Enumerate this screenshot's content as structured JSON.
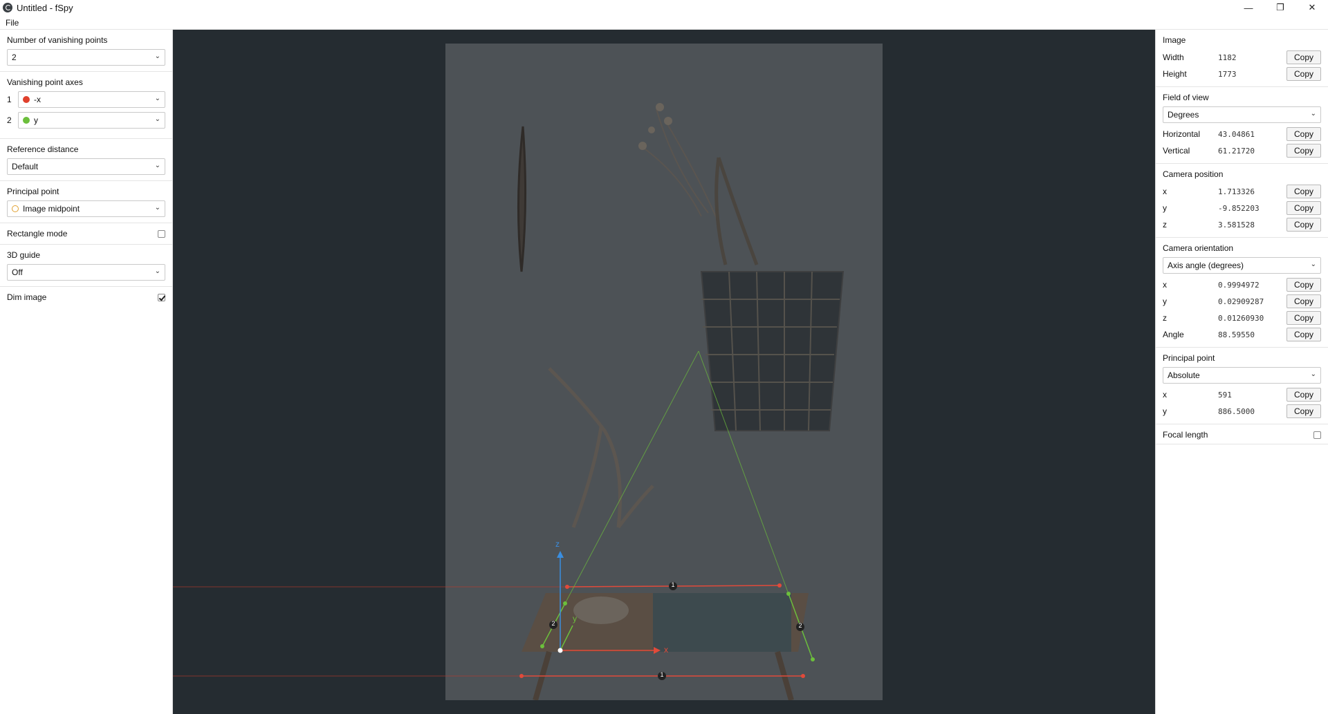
{
  "window": {
    "title": "Untitled - fSpy"
  },
  "menu": {
    "file": "File"
  },
  "left": {
    "num_vp_label": "Number of vanishing points",
    "num_vp_value": "2",
    "vp_axes_label": "Vanishing point axes",
    "vp_axes": [
      {
        "num": "1",
        "value": "-x",
        "color": "#e0402c"
      },
      {
        "num": "2",
        "value": "y",
        "color": "#6cbf3c"
      }
    ],
    "ref_distance_label": "Reference distance",
    "ref_distance_value": "Default",
    "principal_point_label": "Principal point",
    "principal_point_value": "Image midpoint",
    "rectangle_mode_label": "Rectangle mode",
    "rectangle_mode_checked": false,
    "guide_label": "3D guide",
    "guide_value": "Off",
    "dim_image_label": "Dim image",
    "dim_image_checked": true
  },
  "overlay_labels": {
    "vp1_marker": "1",
    "vp2_marker": "2",
    "axis_x": "x",
    "axis_y": "y",
    "axis_z": "z"
  },
  "right": {
    "image": {
      "title": "Image",
      "rows": [
        {
          "label": "Width",
          "value": "1182"
        },
        {
          "label": "Height",
          "value": "1773"
        }
      ]
    },
    "fov": {
      "title": "Field of view",
      "unit": "Degrees",
      "rows": [
        {
          "label": "Horizontal",
          "value": "43.04861"
        },
        {
          "label": "Vertical",
          "value": "61.21720"
        }
      ]
    },
    "cam_pos": {
      "title": "Camera position",
      "rows": [
        {
          "label": "x",
          "value": "1.713326"
        },
        {
          "label": "y",
          "value": "-9.852203"
        },
        {
          "label": "z",
          "value": "3.581528"
        }
      ]
    },
    "cam_orient": {
      "title": "Camera orientation",
      "mode": "Axis angle (degrees)",
      "rows": [
        {
          "label": "x",
          "value": "0.9994972"
        },
        {
          "label": "y",
          "value": "0.02909287"
        },
        {
          "label": "z",
          "value": "0.01260930"
        },
        {
          "label": "Angle",
          "value": "88.59550"
        }
      ]
    },
    "pp": {
      "title": "Principal point",
      "mode": "Absolute",
      "rows": [
        {
          "label": "x",
          "value": "591"
        },
        {
          "label": "y",
          "value": "886.5000"
        }
      ]
    },
    "focal_label": "Focal length",
    "focal_checked": false,
    "copy_label": "Copy"
  }
}
